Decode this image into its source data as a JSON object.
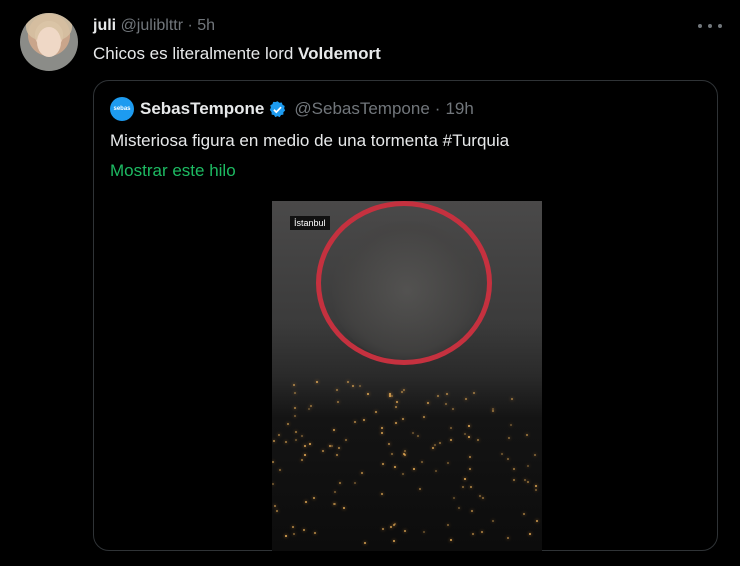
{
  "tweet": {
    "author_name": "juli",
    "author_handle": "@juliblttr",
    "separator": "·",
    "time": "5h",
    "text_plain": "Chicos es literalmente lord ",
    "text_bold": "Voldemort"
  },
  "quote": {
    "avatar_text": "sebas",
    "author_name": "SebasTempone",
    "author_handle": "@SebasTempone",
    "separator": "·",
    "time": "19h",
    "text": "Misteriosa figura en medio de una tormenta #Turquia",
    "show_thread": "Mostrar este hilo",
    "media": {
      "location_label": "İstanbul"
    }
  },
  "colors": {
    "background": "#000000",
    "text": "#e7e9ea",
    "muted": "#71767b",
    "link": "#1dba62",
    "verified": "#1d9bf0",
    "ring": "#c5313f"
  }
}
